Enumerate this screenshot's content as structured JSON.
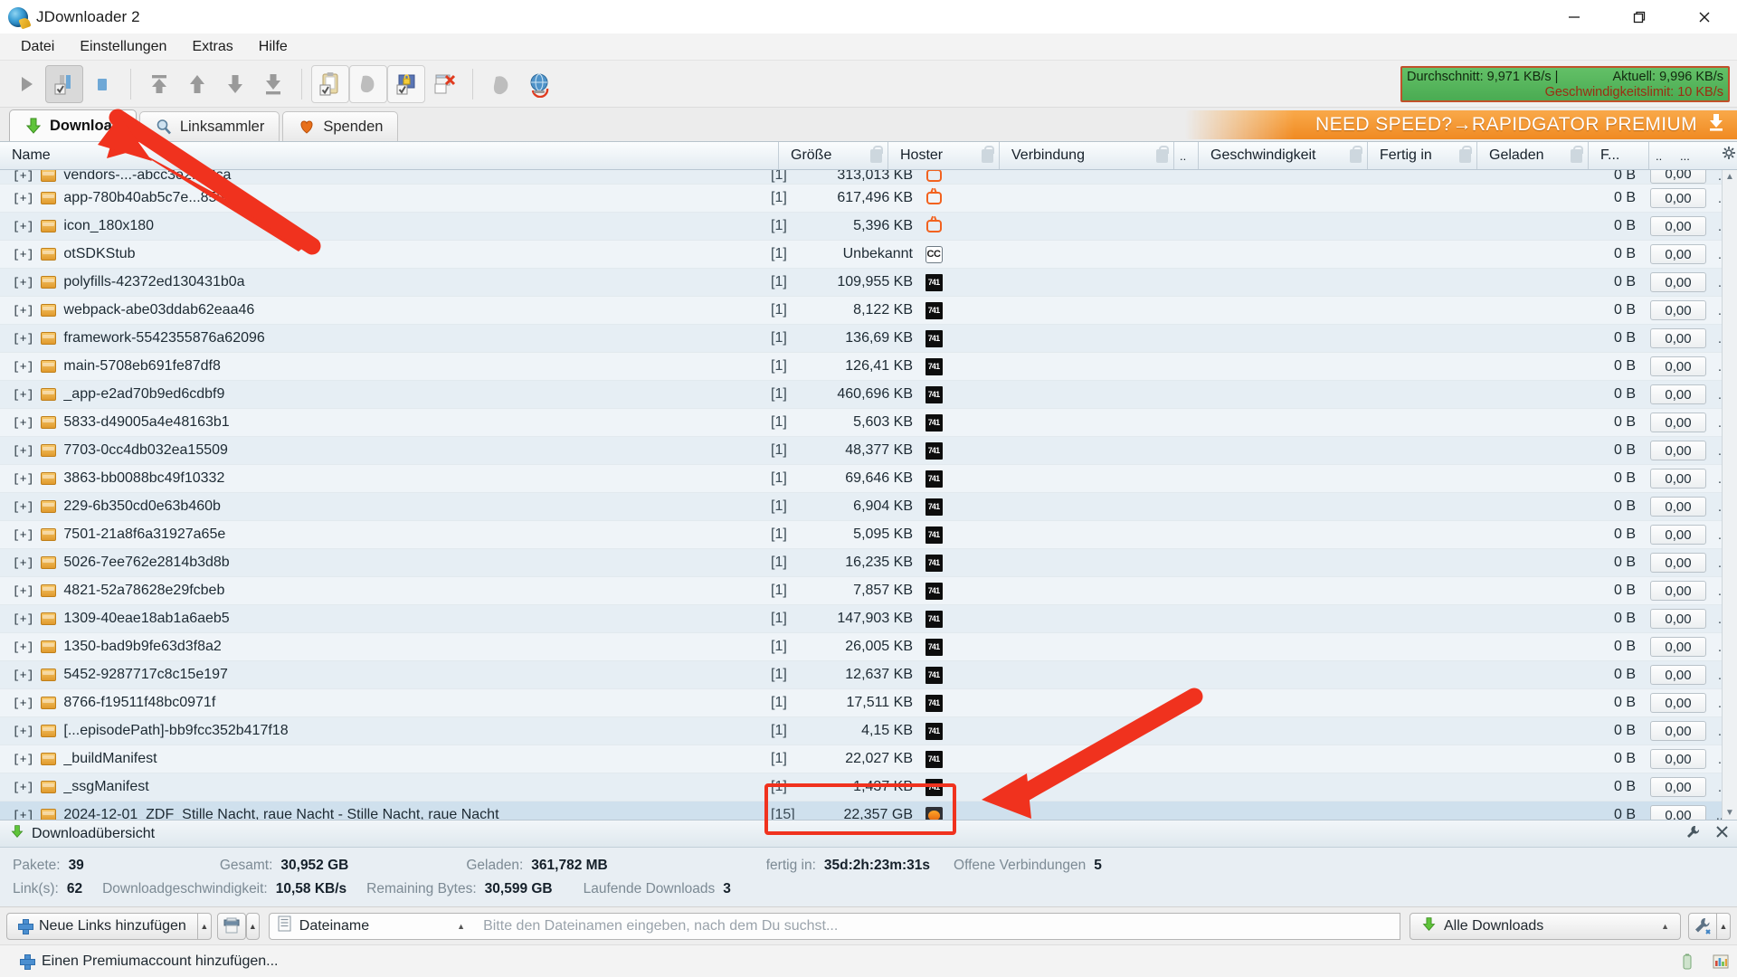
{
  "window": {
    "title": "JDownloader 2",
    "app_icon": "jdownloader-globe-icon",
    "minimize_label": "Minimieren",
    "maximize_label": "Maximieren",
    "close_label": "Schließen"
  },
  "menubar": {
    "items": [
      {
        "label": "Datei"
      },
      {
        "label": "Einstellungen"
      },
      {
        "label": "Extras"
      },
      {
        "label": "Hilfe"
      }
    ]
  },
  "toolbar": {
    "buttons": [
      {
        "name": "start-downloads-button",
        "icon": "play-icon",
        "state": "normal"
      },
      {
        "name": "pause-downloads-button",
        "icon": "pause-icon",
        "state": "pressed"
      },
      {
        "name": "stop-downloads-button",
        "icon": "stop-icon",
        "state": "normal"
      },
      {
        "name": "move-to-top-button",
        "icon": "move-top-icon",
        "state": "normal"
      },
      {
        "name": "move-up-button",
        "icon": "move-up-icon",
        "state": "normal"
      },
      {
        "name": "move-down-button",
        "icon": "move-down-icon",
        "state": "normal"
      },
      {
        "name": "move-to-bottom-button",
        "icon": "move-bottom-icon",
        "state": "normal"
      },
      {
        "name": "clipboard-observer-button",
        "icon": "clipboard-icon",
        "state": "outline"
      },
      {
        "name": "reconnect-button",
        "icon": "reconnect-plug-icon",
        "state": "outline"
      },
      {
        "name": "premium-enabled-button",
        "icon": "lock-image-icon",
        "state": "outline"
      },
      {
        "name": "delete-entries-button",
        "icon": "window-delete-icon",
        "state": "normal"
      },
      {
        "name": "update-button",
        "icon": "refresh-circle-icon",
        "state": "normal"
      },
      {
        "name": "webinterface-button",
        "icon": "globe-refresh-icon",
        "state": "normal"
      }
    ],
    "speed": {
      "average_label": "Durchschnitt: 9,971 KB/s |",
      "current_label": "Aktuell: 9,996 KB/s",
      "limit_label": "Geschwindigkeitslimit: 10 KB/s",
      "bg_color": "#4aab52",
      "border_color": "#c0502a",
      "limit_color": "#9c2d12"
    }
  },
  "tabs": {
    "items": [
      {
        "label": "Download",
        "icon": "download-arrow-icon",
        "active": true
      },
      {
        "label": "Linksammler",
        "icon": "magnifier-icon",
        "active": false
      },
      {
        "label": "Spenden",
        "icon": "heart-icon",
        "active": false
      }
    ],
    "promo": {
      "text": "NEED SPEED?→RAPIDGATOR PREMIUM",
      "icon": "download-badge-icon",
      "color": "#f08a22"
    }
  },
  "table": {
    "columns": [
      {
        "key": "name",
        "label": "Name",
        "lock": false
      },
      {
        "key": "size",
        "label": "Größe",
        "lock": true
      },
      {
        "key": "hoster",
        "label": "Hoster",
        "lock": true
      },
      {
        "key": "connection",
        "label": "Verbindung",
        "lock": true
      },
      {
        "key": "narrow",
        "label": "..",
        "lock": false
      },
      {
        "key": "speed",
        "label": "Geschwindigkeit",
        "lock": true
      },
      {
        "key": "eta",
        "label": "Fertig in",
        "lock": true
      },
      {
        "key": "loaded",
        "label": "Geladen",
        "lock": true
      },
      {
        "key": "f",
        "label": "F...",
        "lock": false
      },
      {
        "key": "dots",
        "label": "..",
        "lock": false
      },
      {
        "key": "gear",
        "label": "...",
        "lock": false
      }
    ],
    "rows": [
      {
        "name": "vendors-...-abcc3e2f9f8ca",
        "count": "[1]",
        "size": "313,013 KB",
        "hoster": "tv",
        "loaded": "0 B",
        "progress": "0,00",
        "dots": "..",
        "clipped": true,
        "selected": false
      },
      {
        "name": "app-780b40ab5c7e...85948",
        "count": "[1]",
        "size": "617,496 KB",
        "hoster": "tv",
        "loaded": "0 B",
        "progress": "0,00",
        "dots": "..",
        "clipped": false,
        "selected": false
      },
      {
        "name": "icon_180x180",
        "count": "[1]",
        "size": "5,396 KB",
        "hoster": "tv",
        "loaded": "0 B",
        "progress": "0,00",
        "dots": "..",
        "clipped": false,
        "selected": false
      },
      {
        "name": "otSDKStub",
        "count": "[1]",
        "size": "Unbekannt",
        "hoster": "cc",
        "loaded": "0 B",
        "progress": "0,00",
        "dots": "..",
        "clipped": false,
        "selected": false
      },
      {
        "name": "polyfills-42372ed130431b0a",
        "count": "[1]",
        "size": "109,955 KB",
        "hoster": "black",
        "loaded": "0 B",
        "progress": "0,00",
        "dots": "..",
        "clipped": false,
        "selected": false
      },
      {
        "name": "webpack-abe03ddab62eaa46",
        "count": "[1]",
        "size": "8,122 KB",
        "hoster": "black",
        "loaded": "0 B",
        "progress": "0,00",
        "dots": "..",
        "clipped": false,
        "selected": false
      },
      {
        "name": "framework-5542355876a62096",
        "count": "[1]",
        "size": "136,69 KB",
        "hoster": "black",
        "loaded": "0 B",
        "progress": "0,00",
        "dots": "..",
        "clipped": false,
        "selected": false
      },
      {
        "name": "main-5708eb691fe87df8",
        "count": "[1]",
        "size": "126,41 KB",
        "hoster": "black",
        "loaded": "0 B",
        "progress": "0,00",
        "dots": "..",
        "clipped": false,
        "selected": false
      },
      {
        "name": "_app-e2ad70b9ed6cdbf9",
        "count": "[1]",
        "size": "460,696 KB",
        "hoster": "black",
        "loaded": "0 B",
        "progress": "0,00",
        "dots": "..",
        "clipped": false,
        "selected": false
      },
      {
        "name": "5833-d49005a4e48163b1",
        "count": "[1]",
        "size": "5,603 KB",
        "hoster": "black",
        "loaded": "0 B",
        "progress": "0,00",
        "dots": "..",
        "clipped": false,
        "selected": false
      },
      {
        "name": "7703-0cc4db032ea15509",
        "count": "[1]",
        "size": "48,377 KB",
        "hoster": "black",
        "loaded": "0 B",
        "progress": "0,00",
        "dots": "..",
        "clipped": false,
        "selected": false
      },
      {
        "name": "3863-bb0088bc49f10332",
        "count": "[1]",
        "size": "69,646 KB",
        "hoster": "black",
        "loaded": "0 B",
        "progress": "0,00",
        "dots": "..",
        "clipped": false,
        "selected": false
      },
      {
        "name": "229-6b350cd0e63b460b",
        "count": "[1]",
        "size": "6,904 KB",
        "hoster": "black",
        "loaded": "0 B",
        "progress": "0,00",
        "dots": "..",
        "clipped": false,
        "selected": false
      },
      {
        "name": "7501-21a8f6a31927a65e",
        "count": "[1]",
        "size": "5,095 KB",
        "hoster": "black",
        "loaded": "0 B",
        "progress": "0,00",
        "dots": "..",
        "clipped": false,
        "selected": false
      },
      {
        "name": "5026-7ee762e2814b3d8b",
        "count": "[1]",
        "size": "16,235 KB",
        "hoster": "black",
        "loaded": "0 B",
        "progress": "0,00",
        "dots": "..",
        "clipped": false,
        "selected": false
      },
      {
        "name": "4821-52a78628e29fcbeb",
        "count": "[1]",
        "size": "7,857 KB",
        "hoster": "black",
        "loaded": "0 B",
        "progress": "0,00",
        "dots": "..",
        "clipped": false,
        "selected": false
      },
      {
        "name": "1309-40eae18ab1a6aeb5",
        "count": "[1]",
        "size": "147,903 KB",
        "hoster": "black",
        "loaded": "0 B",
        "progress": "0,00",
        "dots": "..",
        "clipped": false,
        "selected": false
      },
      {
        "name": "1350-bad9b9fe63d3f8a2",
        "count": "[1]",
        "size": "26,005 KB",
        "hoster": "black",
        "loaded": "0 B",
        "progress": "0,00",
        "dots": "..",
        "clipped": false,
        "selected": false
      },
      {
        "name": "5452-9287717c8c15e197",
        "count": "[1]",
        "size": "12,637 KB",
        "hoster": "black",
        "loaded": "0 B",
        "progress": "0,00",
        "dots": "..",
        "clipped": false,
        "selected": false
      },
      {
        "name": "8766-f19511f48bc0971f",
        "count": "[1]",
        "size": "17,511 KB",
        "hoster": "black",
        "loaded": "0 B",
        "progress": "0,00",
        "dots": "..",
        "clipped": false,
        "selected": false
      },
      {
        "name": "[...episodePath]-bb9fcc352b417f18",
        "count": "[1]",
        "size": "4,15 KB",
        "hoster": "black",
        "loaded": "0 B",
        "progress": "0,00",
        "dots": "..",
        "clipped": false,
        "selected": false
      },
      {
        "name": "_buildManifest",
        "count": "[1]",
        "size": "22,027 KB",
        "hoster": "black",
        "loaded": "0 B",
        "progress": "0,00",
        "dots": "..",
        "clipped": false,
        "selected": false
      },
      {
        "name": "_ssgManifest",
        "count": "[1]",
        "size": "1,437 KB",
        "hoster": "black",
        "loaded": "0 B",
        "progress": "0,00",
        "dots": "..",
        "clipped": false,
        "selected": false
      },
      {
        "name": "2024-12-01_ZDF_Stille Nacht, raue Nacht - Stille Nacht, raue Nacht",
        "count": "[15]",
        "size": "22,357 GB",
        "hoster": "orange",
        "loaded": "0 B",
        "progress": "0,00",
        "dots": "...",
        "clipped": false,
        "selected": true
      }
    ]
  },
  "overview": {
    "title": "Downloadübersicht",
    "title_icon": "download-arrow-icon",
    "tools_icon": "wrench-icon",
    "close_icon": "close-icon",
    "stats": [
      {
        "label": "Pakete:",
        "value": "39"
      },
      {
        "label": "Gesamt:",
        "value": "30,952 GB"
      },
      {
        "label": "Geladen:",
        "value": "361,782 MB"
      },
      {
        "label": "fertig in:",
        "value": "35d:2h:23m:31s"
      },
      {
        "label": "Offene Verbindungen",
        "value": "5"
      },
      {
        "label": "Link(s):",
        "value": "62"
      },
      {
        "label": "Downloadgeschwindigkeit:",
        "value": "10,58 KB/s"
      },
      {
        "label": "Remaining Bytes:",
        "value": "30,599 GB"
      },
      {
        "label": "Laufende Downloads",
        "value": "3"
      }
    ]
  },
  "bottombar": {
    "add_links_label": "Neue Links hinzufügen",
    "add_links_icon": "plus-icon",
    "dropdown_icon": "chevron-down-icon",
    "clipboard_button_icon": "printer-icon",
    "search_mode_label": "Dateiname",
    "search_mode_icon": "list-icon",
    "search_placeholder": "Bitte den Dateinamen eingeben, nach dem Du suchst...",
    "search_value": "",
    "filter_label": "Alle Downloads",
    "filter_icon": "download-arrow-icon",
    "settings_icon": "tools-icon"
  },
  "statusbar": {
    "premium_label": "Einen Premiumaccount hinzufügen...",
    "premium_icon": "plus-icon",
    "right_icons": [
      "battery-icon",
      "chart-icon"
    ]
  }
}
